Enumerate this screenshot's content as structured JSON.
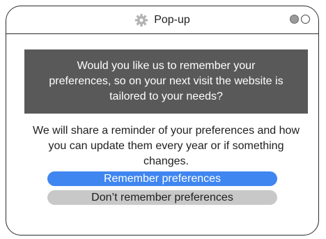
{
  "window": {
    "title": "Pop-up",
    "icon": "gear-icon"
  },
  "banner": {
    "text": "Would you like us to remember your preferences, so on your next visit the website is tailored to your needs?"
  },
  "info": {
    "text": "We will share a reminder of your preferences and how you can update them every year or if something changes."
  },
  "buttons": {
    "remember_label": "Remember preferences",
    "dont_remember_label": "Don’t remember preferences"
  },
  "colors": {
    "banner_bg": "#595959",
    "primary_button": "#3f86f0",
    "secondary_button": "#c8c8c8"
  }
}
